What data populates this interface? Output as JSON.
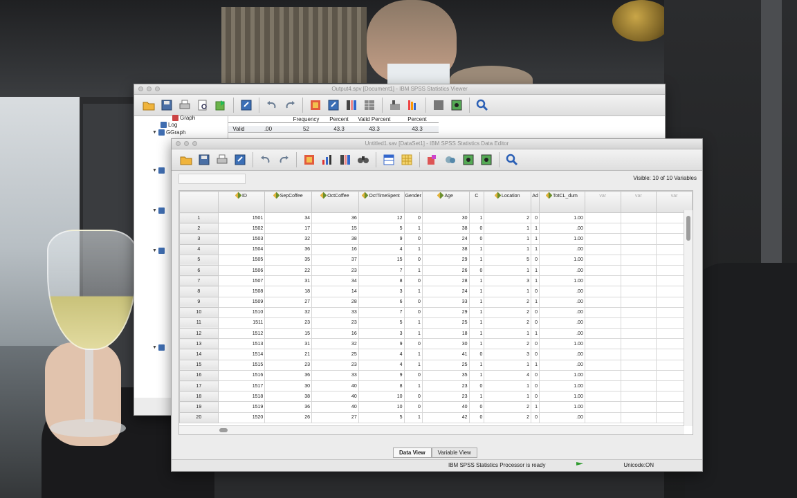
{
  "viewer": {
    "title": "Output4.spv [Document1] - IBM SPSS Statistics Viewer",
    "outline": [
      {
        "label": "Graph",
        "indent": 1
      },
      {
        "label": "Log",
        "indent": 1
      },
      {
        "label": "GGraph",
        "indent": 0
      }
    ],
    "freq_header": [
      "",
      "",
      "Frequency",
      "Percent",
      "Valid Percent",
      "Percent"
    ],
    "freq_row": [
      "Valid",
      ".00",
      "52",
      "43.3",
      "43.3",
      "43.3"
    ]
  },
  "editor": {
    "title": "Untitled1.sav [DataSet1] - IBM SPSS Statistics Data Editor",
    "visible_label": "Visible: 10 of 10 Variables",
    "columns": [
      "ID",
      "SepCoffee",
      "OctCoffee",
      "OctTimeSpent",
      "Gender",
      "Age",
      "C",
      "Location",
      "Ad",
      "TotCL_dum",
      "var",
      "var",
      "var"
    ],
    "rows": [
      [
        "1",
        "1501",
        "34",
        "36",
        "12",
        "0",
        "30",
        "1",
        "2",
        "0",
        "1.00"
      ],
      [
        "2",
        "1502",
        "17",
        "15",
        "5",
        "1",
        "38",
        "0",
        "1",
        "1",
        ".00"
      ],
      [
        "3",
        "1503",
        "32",
        "38",
        "9",
        "0",
        "24",
        "0",
        "1",
        "1",
        "1.00"
      ],
      [
        "4",
        "1504",
        "36",
        "16",
        "4",
        "1",
        "38",
        "1",
        "1",
        "1",
        ".00"
      ],
      [
        "5",
        "1505",
        "35",
        "37",
        "15",
        "0",
        "29",
        "1",
        "5",
        "0",
        "1.00"
      ],
      [
        "6",
        "1506",
        "22",
        "23",
        "7",
        "1",
        "26",
        "0",
        "1",
        "1",
        ".00"
      ],
      [
        "7",
        "1507",
        "31",
        "34",
        "8",
        "0",
        "28",
        "1",
        "3",
        "1",
        "1.00"
      ],
      [
        "8",
        "1508",
        "18",
        "14",
        "3",
        "1",
        "24",
        "1",
        "1",
        "0",
        ".00"
      ],
      [
        "9",
        "1509",
        "27",
        "28",
        "6",
        "0",
        "33",
        "1",
        "2",
        "1",
        ".00"
      ],
      [
        "10",
        "1510",
        "32",
        "33",
        "7",
        "0",
        "29",
        "1",
        "2",
        "0",
        ".00"
      ],
      [
        "11",
        "1511",
        "23",
        "23",
        "5",
        "1",
        "25",
        "1",
        "2",
        "0",
        ".00"
      ],
      [
        "12",
        "1512",
        "15",
        "16",
        "3",
        "1",
        "18",
        "1",
        "1",
        "1",
        ".00"
      ],
      [
        "13",
        "1513",
        "31",
        "32",
        "9",
        "0",
        "30",
        "1",
        "2",
        "0",
        "1.00"
      ],
      [
        "14",
        "1514",
        "21",
        "25",
        "4",
        "1",
        "41",
        "0",
        "3",
        "0",
        ".00"
      ],
      [
        "15",
        "1515",
        "23",
        "23",
        "4",
        "1",
        "25",
        "1",
        "1",
        "1",
        ".00"
      ],
      [
        "16",
        "1516",
        "36",
        "33",
        "9",
        "0",
        "35",
        "1",
        "4",
        "0",
        "1.00"
      ],
      [
        "17",
        "1517",
        "30",
        "40",
        "8",
        "1",
        "23",
        "0",
        "1",
        "0",
        "1.00"
      ],
      [
        "18",
        "1518",
        "38",
        "40",
        "10",
        "0",
        "23",
        "1",
        "1",
        "0",
        "1.00"
      ],
      [
        "19",
        "1519",
        "36",
        "40",
        "10",
        "0",
        "40",
        "0",
        "2",
        "1",
        "1.00"
      ],
      [
        "20",
        "1520",
        "26",
        "27",
        "5",
        "1",
        "42",
        "0",
        "2",
        "0",
        ".00"
      ]
    ],
    "tabs": {
      "data_view": "Data View",
      "variable_view": "Variable View"
    },
    "status": {
      "processor": "IBM SPSS Statistics Processor is ready",
      "unicode": "Unicode:ON"
    }
  },
  "icons": {
    "viewer_toolbar": [
      "open-folder-icon",
      "save-icon",
      "print-icon",
      "print-preview-icon",
      "export-icon",
      "goto-data-icon",
      "undo-icon",
      "redo-icon",
      "goto-case-icon",
      "recall-dialog-icon",
      "variables-icon",
      "insert-table-icon",
      "designate-icon",
      "promote-icon",
      "hide-icon",
      "show-icon",
      "search-icon"
    ],
    "editor_toolbar": [
      "open-folder-icon",
      "save-icon",
      "print-icon",
      "recall-dialog-icon",
      "undo-icon",
      "redo-icon",
      "goto-case-icon",
      "goto-variable-icon",
      "variables-icon",
      "find-icon",
      "insert-cases-icon",
      "insert-variable-icon",
      "split-file-icon",
      "weight-cases-icon",
      "select-cases-icon",
      "value-labels-icon",
      "search-icon"
    ]
  },
  "colors": {
    "accent_blue": "#3f6db0",
    "status_green": "#2d9b2d"
  }
}
